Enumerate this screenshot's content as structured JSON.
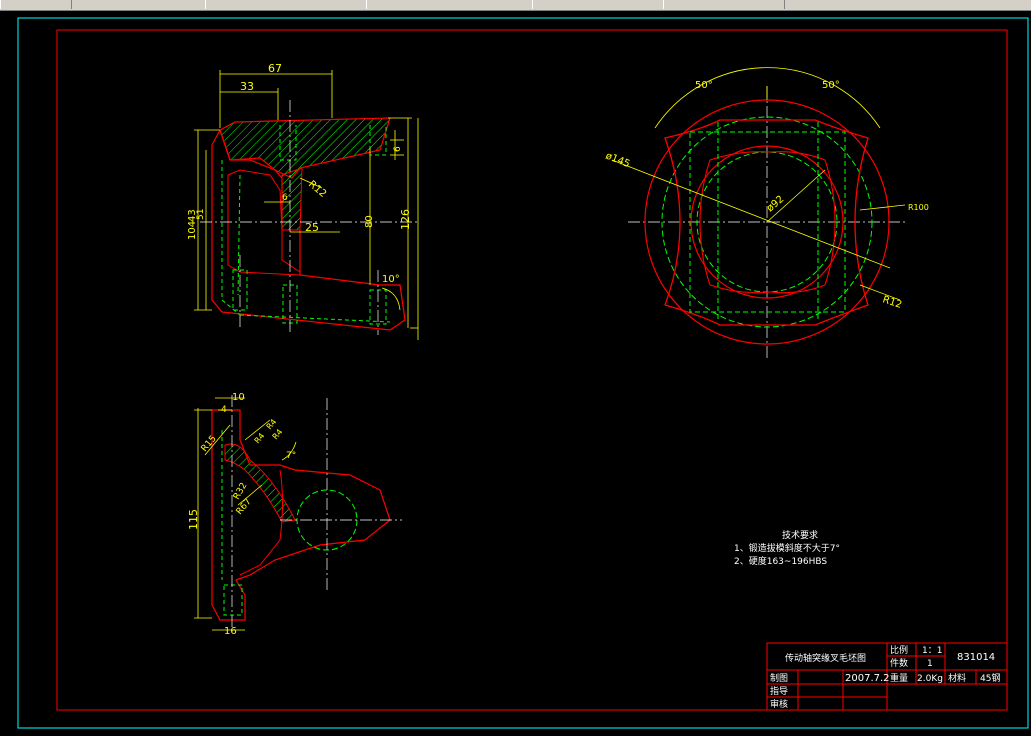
{
  "colors": {
    "background": "#000000",
    "border_outer": "#00ffff",
    "border_inner": "#ff0000",
    "outline": "#ff0000",
    "hidden": "#00ff00",
    "dimension": "#ffff00",
    "hatch": "#00ff00",
    "text": "#ffffff"
  },
  "dims": {
    "front_top_67": "67",
    "front_top_33": "33",
    "front_left_104": "104",
    "front_left_43": "43",
    "front_left_51": "51",
    "front_r12": "R12",
    "front_6": "6",
    "front_25": "25",
    "front_80": "80",
    "front_126": "126",
    "front_right_6": "6",
    "front_10deg": "10°",
    "right_50a": "50°",
    "right_50b": "50°",
    "right_phi145": "ø145",
    "right_phi92": "ø92",
    "right_r100": "R100",
    "right_r12": "R12",
    "side_10": "10",
    "side_4": "4",
    "side_r15": "R15",
    "side_r4a": "R4",
    "side_r4b": "R4",
    "side_r4c": "R4",
    "side_7deg": "7°",
    "side_r32": "R32",
    "side_r67": "R67",
    "side_115": "115",
    "side_16": "16"
  },
  "notes": {
    "title": "技术要求",
    "line1": "1、锻造拔模斜度不大于7°",
    "line2": "2、硬度163~196HBS"
  },
  "title_block": {
    "part_name": "传动轴突缘叉毛坯图",
    "scale_label": "比例",
    "scale_value": "1：1",
    "qty_label": "件数",
    "qty_value": "1",
    "drawing_no": "831014",
    "drawn_label": "制图",
    "date": "2007.7.2",
    "weight_label": "重量",
    "weight_value": "2.0Kg",
    "material_label": "材料",
    "material_value": "45钢",
    "guide_label": "指导",
    "review_label": "审核"
  }
}
